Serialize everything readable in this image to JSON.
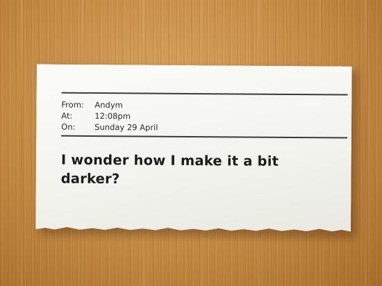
{
  "receipt": {
    "from_label": "From:",
    "from_value": "Andym",
    "at_label": "At:",
    "at_value": "12:08pm",
    "on_label": "On:",
    "on_value": "Sunday 29 April",
    "message": "I wonder how I make it a bit darker?"
  },
  "colors": {
    "wood": "#c48a45",
    "paper": "#f3f3ee",
    "ink": "#1c1c1c"
  }
}
